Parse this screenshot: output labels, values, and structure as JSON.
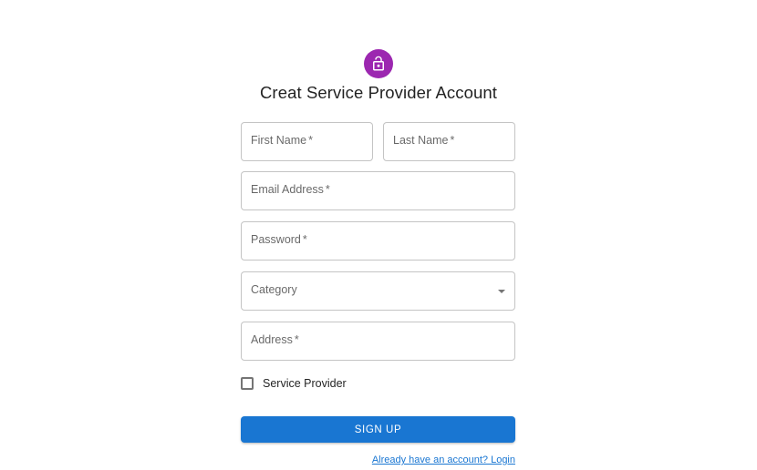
{
  "header": {
    "icon": "lock-open-icon",
    "title": "Creat Service Provider Account"
  },
  "form": {
    "first_name": {
      "label": "First Name",
      "required_mark": "*",
      "value": ""
    },
    "last_name": {
      "label": "Last Name",
      "required_mark": "*",
      "value": ""
    },
    "email": {
      "label": "Email Address",
      "required_mark": "*",
      "value": ""
    },
    "password": {
      "label": "Password",
      "required_mark": "*",
      "value": ""
    },
    "category": {
      "label": "Category",
      "icon": "chevron-down-icon",
      "value": ""
    },
    "address": {
      "label": "Address",
      "required_mark": "*",
      "value": ""
    },
    "service_provider_checkbox": {
      "label": "Service Provider",
      "checked": false
    },
    "submit_label": "Sign Up",
    "login_link": "Already have an account? Login"
  },
  "colors": {
    "avatar": "#9c27b0",
    "primary": "#1976d2"
  }
}
